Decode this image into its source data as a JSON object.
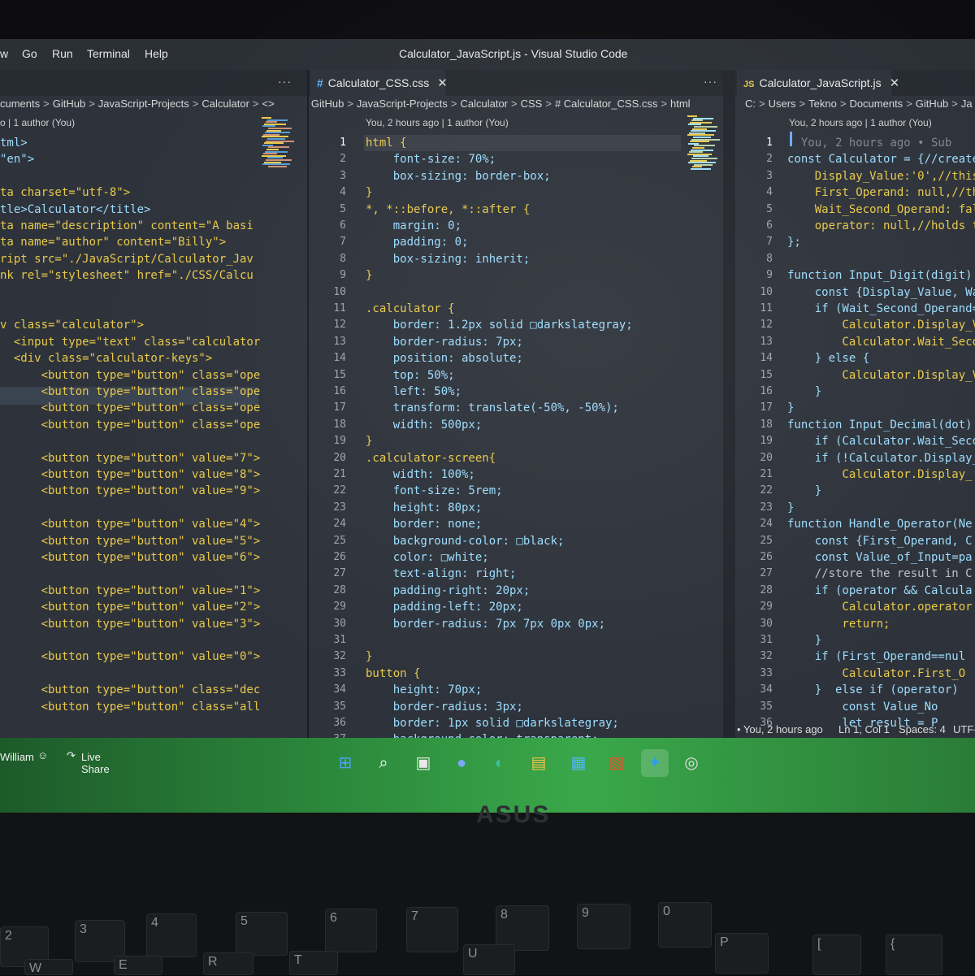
{
  "titlebar": {
    "menu": [
      "w",
      "Go",
      "Run",
      "Terminal",
      "Help"
    ],
    "window_title": "Calculator_JavaScript.js - Visual Studio Code"
  },
  "left_pane": {
    "breadcrumb": [
      "cuments",
      "GitHub",
      "JavaScript-Projects",
      "Calculator",
      "<>"
    ],
    "blame": "o | 1 author (You)",
    "lines": [
      "tml>",
      "\"en\">",
      "",
      "ta charset=\"utf-8\">",
      "tle>Calculator</title>",
      "ta name=\"description\" content=\"A basi",
      "ta name=\"author\" content=\"Billy\">",
      "ript src=\"./JavaScript/Calculator_Jav",
      "nk rel=\"stylesheet\" href=\"./CSS/Calcu",
      "",
      "",
      "v class=\"calculator\">",
      "  <input type=\"text\" class=\"calculator",
      "  <div class=\"calculator-keys\">",
      "      <button type=\"button\" class=\"ope",
      "      <button type=\"button\" class=\"ope",
      "      <button type=\"button\" class=\"ope",
      "      <button type=\"button\" class=\"ope",
      "",
      "      <button type=\"button\" value=\"7\">",
      "      <button type=\"button\" value=\"8\">",
      "      <button type=\"button\" value=\"9\">",
      "",
      "      <button type=\"button\" value=\"4\">",
      "      <button type=\"button\" value=\"5\">",
      "      <button type=\"button\" value=\"6\">",
      "",
      "      <button type=\"button\" value=\"1\">",
      "      <button type=\"button\" value=\"2\">",
      "      <button type=\"button\" value=\"3\">",
      "",
      "      <button type=\"button\" value=\"0\">",
      "",
      "      <button type=\"button\" class=\"dec",
      "      <button type=\"button\" class=\"all"
    ]
  },
  "middle_pane": {
    "tab_label": "Calculator_CSS.css",
    "breadcrumb": [
      "e GitHub",
      "JavaScript-Projects",
      "Calculator",
      "CSS",
      "# Calculator_CSS.css",
      "html"
    ],
    "blame": "You, 2 hours ago | 1 author (You)",
    "lines": [
      "html {",
      "    font-size: 70%;",
      "    box-sizing: border-box;",
      "}",
      "*, *::before, *::after {",
      "    margin: 0;",
      "    padding: 0;",
      "    box-sizing: inherit;",
      "}",
      "",
      ".calculator {",
      "    border: 1.2px solid □darkslategray;",
      "    border-radius: 7px;",
      "    position: absolute;",
      "    top: 50%;",
      "    left: 50%;",
      "    transform: translate(-50%, -50%);",
      "    width: 500px;",
      "}",
      ".calculator-screen{",
      "    width: 100%;",
      "    font-size: 5rem;",
      "    height: 80px;",
      "    border: none;",
      "    background-color: □black;",
      "    color: □white;",
      "    text-align: right;",
      "    padding-right: 20px;",
      "    padding-left: 20px;",
      "    border-radius: 7px 7px 0px 0px;",
      "",
      "}",
      "button {",
      "    height: 70px;",
      "    border-radius: 3px;",
      "    border: 1px solid □darkslategray;",
      "    background-color: transparent;"
    ]
  },
  "right_pane": {
    "tab_label": "Calculator_JavaScript.js",
    "tab_icon_text": "JS",
    "breadcrumb": [
      "C:",
      "Users",
      "Tekno",
      "Documents",
      "GitHub",
      "Ja"
    ],
    "blame": "You, 2 hours ago | 1 author (You)",
    "lines": [
      "  You, 2 hours ago • Sub",
      "const Calculator = {//creates",
      "    Display_Value:'0',//this",
      "    First_Operand: null,//thi",
      "    Wait_Second_Operand: fals",
      "    operator: null,//holds th",
      "};",
      "",
      "function Input_Digit(digit)",
      "    const {Display_Value, Wa",
      "    if (Wait_Second_Operand=",
      "        Calculator.Display_V",
      "        Calculator.Wait_Seco",
      "    } else {",
      "        Calculator.Display_V",
      "    }",
      "}",
      "function Input_Decimal(dot)",
      "    if (Calculator.Wait_Seco",
      "    if (!Calculator.Display_",
      "        Calculator.Display_",
      "    }",
      "}",
      "function Handle_Operator(Ne",
      "    const {First_Operand, C",
      "    const Value_of_Input=pa",
      "    //store the result in C",
      "    if (operator && Calcula",
      "        Calculator.operator",
      "        return;",
      "    }",
      "    if (First_Operand==nul",
      "        Calculator.First_O",
      "    }  else if (operator)",
      "        const Value_No",
      "        let result = P"
    ]
  },
  "status_bar": {
    "left_user": "William",
    "live_share": "Live Share",
    "blame": "You, 2 hours ago",
    "cursor_pos": "Ln 1, Col 1",
    "spaces": "Spaces: 4",
    "encoding": "UTF-"
  },
  "laptop": {
    "brand": "ASUS",
    "keys": [
      "2",
      "3",
      "4",
      "5",
      "6",
      "7",
      "8",
      "9",
      "0",
      "P",
      "U",
      "R",
      "T",
      "E",
      "W",
      "[",
      "{"
    ]
  },
  "colors": {
    "editor_bg": "#2e333b",
    "keyword": "#c586c0",
    "selector": "#e8c94a",
    "property": "#9cdcfe",
    "string": "#ce9178",
    "number": "#b5cea8",
    "tag": "#569cd6",
    "taskbar_green": "#3aa84a"
  },
  "taskbar_icons": [
    "windows-start-icon",
    "search-icon",
    "task-view-icon",
    "chat-icon",
    "edge-icon",
    "file-explorer-icon",
    "store-icon",
    "office-icon",
    "vscode-icon",
    "bulb-icon"
  ]
}
